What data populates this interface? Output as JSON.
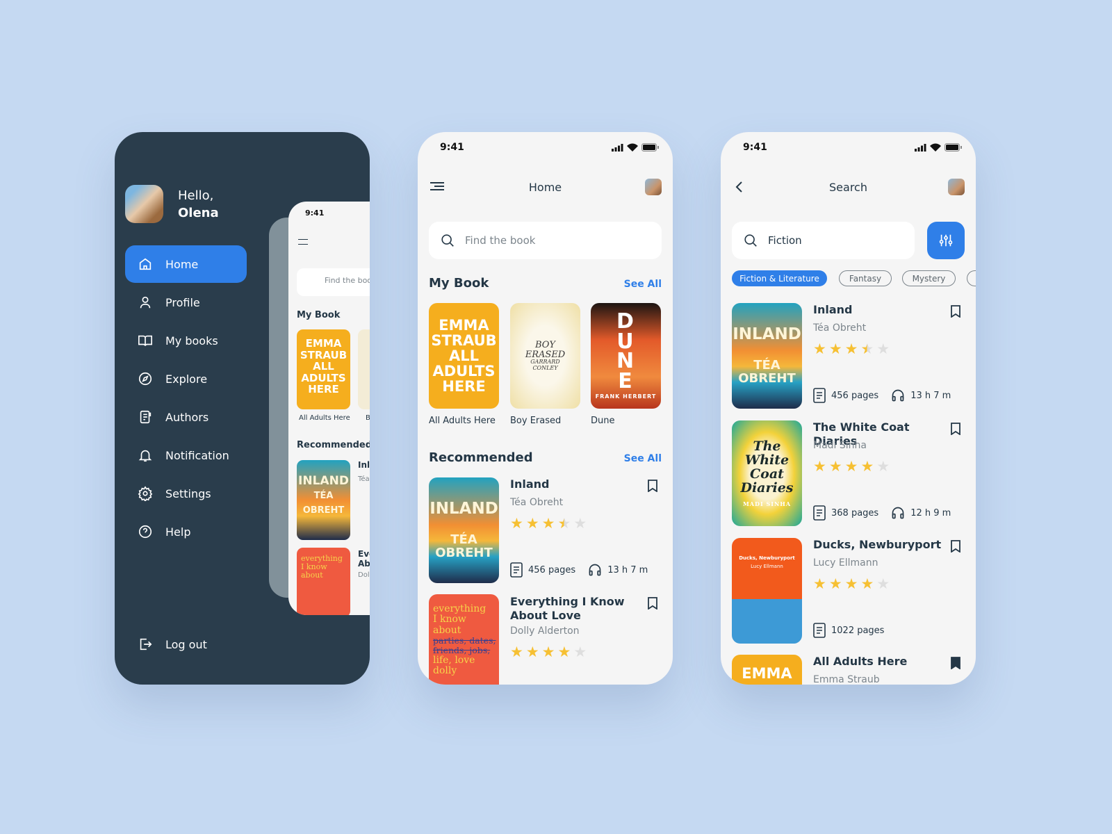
{
  "colors": {
    "accent": "#2f7fe8",
    "sidebar": "#2a3d4c",
    "background": "#c5d9f2",
    "star": "#f6c033"
  },
  "status": {
    "time": "9:41"
  },
  "drawer": {
    "greeting": "Hello,",
    "user_name": "Olena",
    "items": [
      {
        "label": "Home",
        "icon": "home-icon",
        "active": true
      },
      {
        "label": "Profile",
        "icon": "user-icon"
      },
      {
        "label": "My books",
        "icon": "book-open-icon"
      },
      {
        "label": "Explore",
        "icon": "compass-icon"
      },
      {
        "label": "Authors",
        "icon": "authors-icon"
      },
      {
        "label": "Notification",
        "icon": "bell-icon"
      },
      {
        "label": "Settings",
        "icon": "gear-icon"
      },
      {
        "label": "Help",
        "icon": "help-icon"
      }
    ],
    "logout": "Log out",
    "preview": {
      "search_placeholder": "Find the boo",
      "my_book": "My Book",
      "book_title": "All Adults Here",
      "book_title2": "B",
      "recommended": "Recommended",
      "rec_title": "Inla",
      "rec_author": "Téa",
      "rec2_title": "Eve",
      "rec2_title2": "Ab",
      "rec2_author": "Dol"
    }
  },
  "home": {
    "title": "Home",
    "search_placeholder": "Find the book",
    "my_book": {
      "heading": "My Book",
      "see_all": "See All",
      "books": [
        {
          "title": "All Adults Here",
          "cover_text": [
            "EMMA",
            "STRAUB",
            "ALL",
            "ADULTS",
            "HERE"
          ]
        },
        {
          "title": "Boy Erased",
          "cover_text": [
            "BOY",
            "ERASED",
            "GARRARD",
            "CONLEY"
          ]
        },
        {
          "title": "Dune",
          "cover_text": [
            "DUNE",
            "FRANK HERBERT"
          ]
        }
      ]
    },
    "recommended": {
      "heading": "Recommended",
      "see_all": "See All",
      "items": [
        {
          "title": "Inland",
          "author": "Téa Obreht",
          "rating": 3.5,
          "pages": "456 pages",
          "audio": "13 h 7 m",
          "cover_text": [
            "INLAND",
            "TÉA",
            "OBREHT"
          ]
        },
        {
          "title": "Everything I Know About Love",
          "author": "Dolly Alderton",
          "rating": 4,
          "cover_text": [
            "everything",
            "I know",
            "about",
            "parties, dates,",
            "friends, jobs,",
            "life, love",
            "dolly"
          ]
        }
      ]
    }
  },
  "search": {
    "title": "Search",
    "query": "Fiction",
    "chips": [
      {
        "label": "Fiction & Literature",
        "active": true
      },
      {
        "label": "Fantasy"
      },
      {
        "label": "Mystery"
      }
    ],
    "results": [
      {
        "title": "Inland",
        "author": "Téa Obreht",
        "rating": 3.5,
        "pages": "456 pages",
        "audio": "13 h 7 m",
        "cover_text": [
          "INLAND",
          "TÉA",
          "OBREHT"
        ]
      },
      {
        "title": "The White Coat Diaries",
        "author": "Madi Sinha",
        "rating": 4,
        "pages": "368 pages",
        "audio": "12 h 9 m",
        "cover_text": [
          "The",
          "White",
          "Coat",
          "Diaries",
          "MADI SINHA"
        ]
      },
      {
        "title": "Ducks, Newburyport",
        "author": "Lucy Ellmann",
        "rating": 4,
        "pages": "1022 pages",
        "cover_text": [
          "Ducks, Newburyport",
          "Lucy Ellmann"
        ]
      },
      {
        "title": "All Adults Here",
        "author": "Emma Straub",
        "bookmarked": true,
        "cover_text": [
          "EMMA"
        ]
      }
    ]
  }
}
